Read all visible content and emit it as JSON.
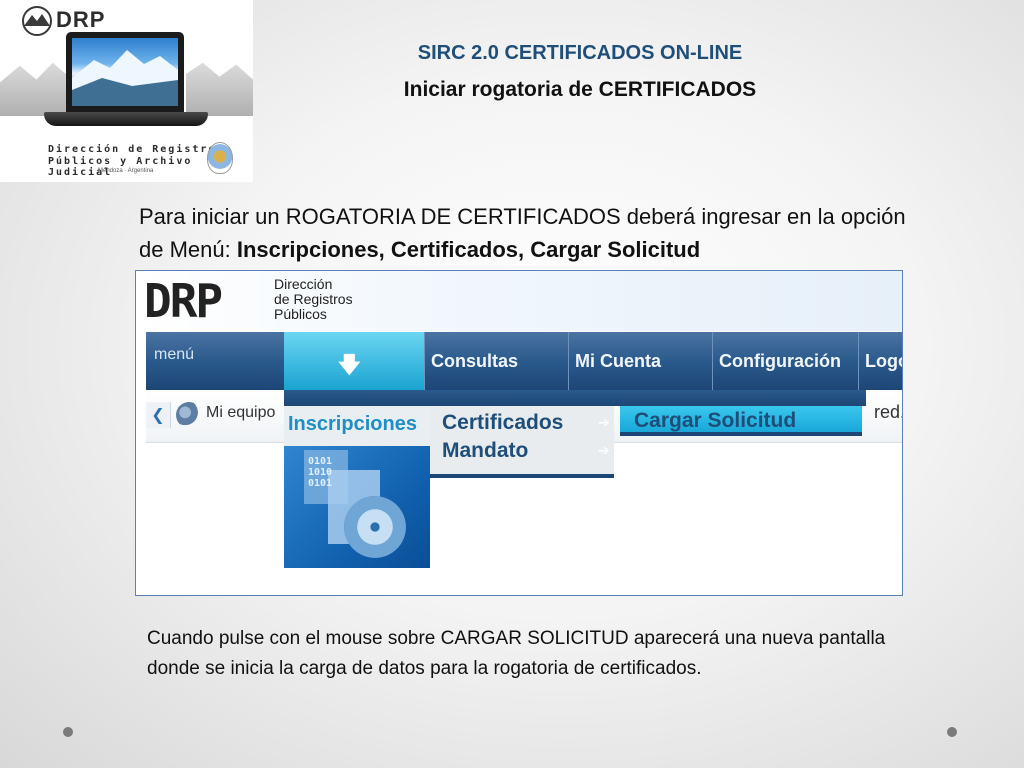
{
  "logo": {
    "brand": "DRP",
    "org_line1": "Dirección de Registros",
    "org_line2": "Públicos y Archivo Judicial",
    "org_line3": "Mendoza · Argentina"
  },
  "slide": {
    "title": "SIRC 2.0 CERTIFICADOS ON-LINE",
    "subtitle": "Iniciar rogatoria de CERTIFICADOS",
    "intro_prefix": "Para iniciar un ROGATORIA DE CERTIFICADOS deberá ingresar en la opción de Menú: ",
    "intro_bold": "Inscripciones, Certificados, Cargar Solicitud",
    "outro": "Cuando pulse con el mouse sobre CARGAR SOLICITUD aparecerá una nueva pantalla donde se inicia la carga de datos para la rogatoria de certificados."
  },
  "screenshot": {
    "app_logo": "DRP",
    "app_org_line1": "Dirección",
    "app_org_line2": "de Registros",
    "app_org_line3": "Públicos",
    "menu_label": "menú",
    "arrow_glyph": "🡇",
    "menu_items": [
      "Consultas",
      "Mi Cuenta",
      "Configuración",
      "Logo"
    ],
    "back_glyph": "❮",
    "equipo_label": "Mi equipo",
    "right_text": "red.",
    "active_menu": "Inscripciones",
    "dropdown_items": [
      "Certificados",
      "Mandato"
    ],
    "chevron_glyph": "➔",
    "submenu_item": "Cargar Solicitud",
    "cert_bits": "0101\n1010\n0101"
  }
}
